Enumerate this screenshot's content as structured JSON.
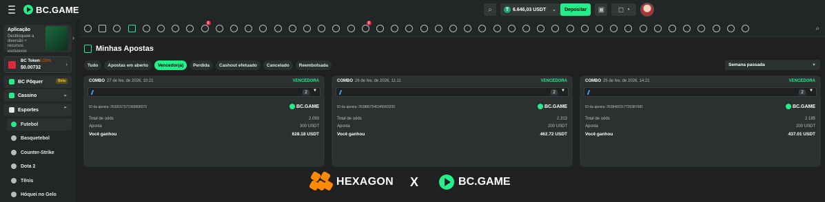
{
  "header": {
    "brand": "BC.GAME",
    "balance": "6.646,03 USDT",
    "deposit_label": "Depositar"
  },
  "sidebar": {
    "promo_title": "Aplicação",
    "promo_sub": "Desbloqueie a diversão + recursos exclusivos",
    "token_name": "BC Token",
    "token_change": "0.02%",
    "token_price": "$0.00732",
    "items": [
      {
        "label": "BC Pôquer",
        "tag": "Beta"
      },
      {
        "label": "Cassino"
      },
      {
        "label": "Esportes"
      }
    ],
    "sports": [
      "Futebol",
      "Basquetebol",
      "Counter-Strike",
      "Dota 2",
      "Tênis",
      "Hóquei no Gelo"
    ]
  },
  "sports_bar": {
    "badges": [
      "8",
      "8"
    ],
    "live_label": "LIVE"
  },
  "page": {
    "title": "Minhas Apostas",
    "filters": [
      "Tudo",
      "Apostas em aberto",
      "Vencedor(a)",
      "Perdida",
      "Cashout efetuado",
      "Cancelado",
      "Reembolsada"
    ],
    "active_filter": "Vencedor(a)",
    "period": "Semana passada"
  },
  "cards": [
    {
      "type": "COMBO",
      "date": "27 de fev. de 2026, 10:21",
      "status": "VENCEDORA",
      "selections": "2",
      "bet_id": "ID da aposta: 2639157372365808370",
      "brand": "BC.GAME",
      "odds_label": "Total de odds",
      "odds": "2.093",
      "stake_label": "Aposta",
      "stake": "300 USDT",
      "won_label": "Você ganhou",
      "won": "628.18 USDT"
    },
    {
      "type": "COMBO",
      "date": "26 de fev. de 2026, 11:11",
      "status": "VENCEDORA",
      "selections": "2",
      "bet_id": "ID da aposta: 2638807545345993230",
      "brand": "BC.GAME",
      "odds_label": "Total de odds",
      "odds": "2.313",
      "stake_label": "Aposta",
      "stake": "200 USDT",
      "won_label": "Você ganhou",
      "won": "462.72 USDT"
    },
    {
      "type": "COMBO",
      "date": "25 de fev. de 2026, 14:21",
      "status": "VENCEDORA",
      "selections": "2",
      "bet_id": "ID da aposta: 2638492217725387681",
      "brand": "BC.GAME",
      "odds_label": "Total de odds",
      "odds": "2.185",
      "stake_label": "Aposta",
      "stake": "200 USDT",
      "won_label": "Você ganhou",
      "won": "437.01 USDT"
    }
  ],
  "footer": {
    "left_brand": "HEXAGON",
    "separator": "X",
    "right_brand": "BC.GAME"
  },
  "colors": {
    "accent": "#24ee89",
    "bg": "#1e2021",
    "panel": "#2d3031"
  }
}
